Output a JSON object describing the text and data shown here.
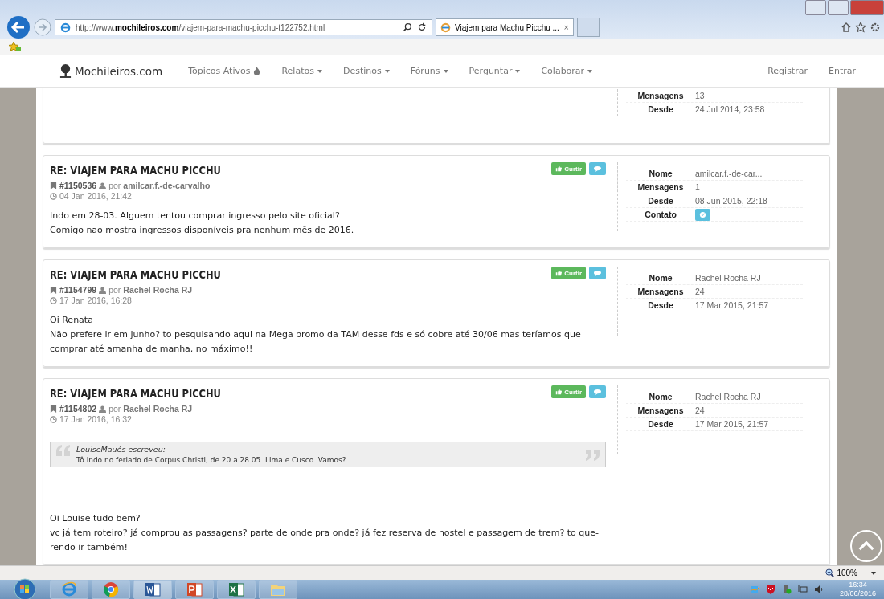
{
  "browser": {
    "address": "http://www.**mochileiros.com**/viajem-para-machu-picchu-t122752.html",
    "tab": {
      "title": "Viajem para Machu Picchu ...",
      "close": "×",
      "selected": true
    }
  },
  "site_nav": {
    "brand": "Mochileiros.com",
    "items": [
      {
        "label": "Tópicos Ativos",
        "kind": "hot"
      },
      {
        "label": "Relatos",
        "kind": "dropdown"
      },
      {
        "label": "Destinos",
        "kind": "dropdown"
      },
      {
        "label": "Fóruns",
        "kind": "dropdown"
      },
      {
        "label": "Perguntar",
        "kind": "dropdown"
      },
      {
        "label": "Colaborar",
        "kind": "dropdown"
      }
    ],
    "right": [
      "Registrar",
      "Entrar"
    ]
  },
  "posts": [
    {
      "profile": [
        {
          "label": "Mensagens",
          "value": "13",
          "kind": "text"
        },
        {
          "label": "Desde",
          "value": "24 Jul 2014, 23:58",
          "kind": "text"
        }
      ]
    },
    {
      "title": "RE: VIAJEM PARA MACHU PICCHU",
      "like": "Curtir",
      "id": "#1150536",
      "by": "por",
      "author": "amilcar.f.-de-carvalho",
      "date": "04 Jan 2016, 21:42",
      "body": [
        "Indo em 28-03. Alguem tentou comprar ingresso pelo site oficial?",
        "Comigo nao mostra ingressos disponíveis pra nenhum mês de 2016."
      ],
      "profile": [
        {
          "label": "Nome",
          "value": "amilcar.f.-de-car...",
          "kind": "text"
        },
        {
          "label": "Mensagens",
          "value": "1",
          "kind": "text"
        },
        {
          "label": "Desde",
          "value": "08 Jun 2015, 22:18",
          "kind": "text"
        },
        {
          "label": "Contato",
          "kind": "contact"
        }
      ]
    },
    {
      "title": "RE: VIAJEM PARA MACHU PICCHU",
      "like": "Curtir",
      "id": "#1154799",
      "by": "por",
      "author": "Rachel Rocha RJ",
      "date": "17 Jan 2016, 16:28",
      "body": [
        "Oi Renata",
        "Não prefere ir em junho? to pesquisando aqui na Mega promo da TAM desse fds e só cobre até 30/06 mas teríamos que",
        "comprar até amanha de manha, no máximo!!"
      ],
      "profile": [
        {
          "label": "Nome",
          "value": "Rachel Rocha RJ",
          "kind": "text"
        },
        {
          "label": "Mensagens",
          "value": "24",
          "kind": "text"
        },
        {
          "label": "Desde",
          "value": "17 Mar 2015, 21:57",
          "kind": "text"
        }
      ]
    },
    {
      "title": "RE: VIAJEM PARA MACHU PICCHU",
      "like": "Curtir",
      "id": "#1154802",
      "by": "por",
      "author": "Rachel Rocha RJ",
      "date": "17 Jan 2016, 16:32",
      "quote": {
        "author": "LouiseMaués escreveu:",
        "text": "Tô indo no feriado de Corpus Christi, de 20 a 28.05. Lima e Cusco. Vamos?"
      },
      "body": [
        "Oi Louise tudo bem?",
        "vc já tem roteiro? já comprou as passagens? parte de onde pra onde? já fez reserva de hostel e passagem de trem? to que-",
        "rendo ir também!"
      ],
      "profile": [
        {
          "label": "Nome",
          "value": "Rachel Rocha RJ",
          "kind": "text"
        },
        {
          "label": "Mensagens",
          "value": "24",
          "kind": "text"
        },
        {
          "label": "Desde",
          "value": "17 Mar 2015, 21:57",
          "kind": "text"
        }
      ]
    }
  ],
  "status_bar": {
    "zoom": "100%"
  },
  "taskbar": {
    "time": "16:34",
    "date": "28/06/2016"
  }
}
